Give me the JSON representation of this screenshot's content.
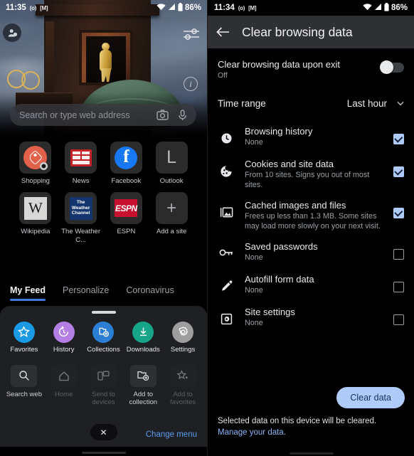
{
  "left_panel": {
    "status_bar": {
      "time": "11:35",
      "notif_icons": [
        "circle-dot-icon",
        "gmail-icon"
      ],
      "wifi_icon": "wifi-icon",
      "signal_icon": "signal-triangle-icon",
      "battery_icon": "battery-icon",
      "battery_text": "86%"
    },
    "avatar_icon": "account-avatar-icon",
    "tune_icon": "tune-sliders-icon",
    "info_icon": "info-icon",
    "info_glyph": "i",
    "search": {
      "placeholder": "Search or type web address",
      "camera_icon": "camera-icon",
      "mic_icon": "microphone-icon"
    },
    "shortcuts": [
      {
        "label": "Shopping",
        "icon": "shopping-tag-icon"
      },
      {
        "label": "News",
        "icon": "news-icon"
      },
      {
        "label": "Facebook",
        "icon": "facebook-icon",
        "glyph": "f"
      },
      {
        "label": "Outlook",
        "icon": "outlook-letter-icon",
        "glyph": "L"
      },
      {
        "label": "Wikipedia",
        "icon": "wikipedia-icon",
        "glyph": "W"
      },
      {
        "label": "The Weather C...",
        "icon": "weather-channel-icon",
        "glyph": "The Weather Channel"
      },
      {
        "label": "ESPN",
        "icon": "espn-icon",
        "glyph": "ESPN"
      },
      {
        "label": "Add a site",
        "icon": "plus-icon",
        "glyph": "+"
      }
    ],
    "feed_tabs": [
      {
        "label": "My Feed",
        "active": true
      },
      {
        "label": "Personalize",
        "active": false
      },
      {
        "label": "Coronavirus",
        "active": false
      }
    ],
    "menu_sheet": {
      "row1": [
        {
          "label": "Favorites",
          "icon": "star-icon",
          "color": "#1a9ae5"
        },
        {
          "label": "History",
          "icon": "history-clock-icon",
          "color": "#b47ee5"
        },
        {
          "label": "Collections",
          "icon": "collections-add-icon",
          "color": "#2a7fd4"
        },
        {
          "label": "Downloads",
          "icon": "download-icon",
          "color": "#17a589"
        },
        {
          "label": "Settings",
          "icon": "gear-icon",
          "color": "#9e9e9e"
        }
      ],
      "row2": [
        {
          "label": "Search web",
          "icon": "search-icon",
          "enabled": true
        },
        {
          "label": "Home",
          "icon": "home-icon",
          "enabled": false
        },
        {
          "label": "Send to devices",
          "icon": "send-to-devices-icon",
          "enabled": false
        },
        {
          "label": "Add to collection",
          "icon": "add-to-collection-icon",
          "enabled": true
        },
        {
          "label": "Add to favorites",
          "icon": "add-to-favorites-icon",
          "enabled": false
        }
      ],
      "close_label": "✕",
      "change_menu_label": "Change menu"
    }
  },
  "right_panel": {
    "status_bar": {
      "time": "11:34",
      "notif_icons": [
        "circle-dot-icon",
        "gmail-icon"
      ],
      "battery_text": "86%"
    },
    "header": {
      "back_icon": "back-arrow-icon",
      "title": "Clear browsing data"
    },
    "upon_exit": {
      "title": "Clear browsing data upon exit",
      "subtitle": "Off",
      "toggle_state": "off"
    },
    "time_range": {
      "label": "Time range",
      "value": "Last hour",
      "chevron_icon": "chevron-down-icon"
    },
    "items": [
      {
        "icon": "clock-icon",
        "title": "Browsing history",
        "subtitle": "None",
        "checked": true
      },
      {
        "icon": "cookie-icon",
        "title": "Cookies and site data",
        "subtitle": "From 10 sites. Signs you out of most sites.",
        "checked": true
      },
      {
        "icon": "image-icon",
        "title": "Cached images and files",
        "subtitle": "Frees up less than 1.3 MB. Some sites may load more slowly on your next visit.",
        "checked": true
      },
      {
        "icon": "key-icon",
        "title": "Saved passwords",
        "subtitle": "None",
        "checked": false
      },
      {
        "icon": "pencil-icon",
        "title": "Autofill form data",
        "subtitle": "None",
        "checked": false
      },
      {
        "icon": "site-settings-icon",
        "title": "Site settings",
        "subtitle": "None",
        "checked": false
      }
    ],
    "clear_data_button": "Clear data",
    "footnote_text": "Selected data on this device will be cleared. ",
    "footnote_link": "Manage your data.",
    "colors": {
      "accent_checkbox": "#aecbfa",
      "link": "#8ab4f8",
      "button_bg": "#aecbfa",
      "button_text": "#15325e",
      "header_bg": "#2f3033"
    }
  }
}
